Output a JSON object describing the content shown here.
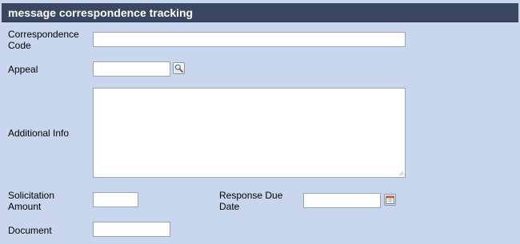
{
  "panel": {
    "title": "message correspondence tracking"
  },
  "fields": {
    "correspondence_code": {
      "label_line1": "Correspondence",
      "label_line2": "Code",
      "value": ""
    },
    "appeal": {
      "label": "Appeal",
      "value": "",
      "lookup_icon": "magnifier-icon"
    },
    "additional_info": {
      "label": "Additional Info",
      "value": ""
    },
    "solicitation_amount": {
      "label_line1": "Solicitation",
      "label_line2": "Amount",
      "value": ""
    },
    "response_due_date": {
      "label_line1": "Response Due",
      "label_line2": "Date",
      "value": "",
      "picker_icon": "calendar-icon"
    },
    "document": {
      "label": "Document",
      "value": ""
    }
  },
  "colors": {
    "background": "#c9d7ee",
    "header": "#3a4763",
    "header_text": "#ffffff"
  }
}
